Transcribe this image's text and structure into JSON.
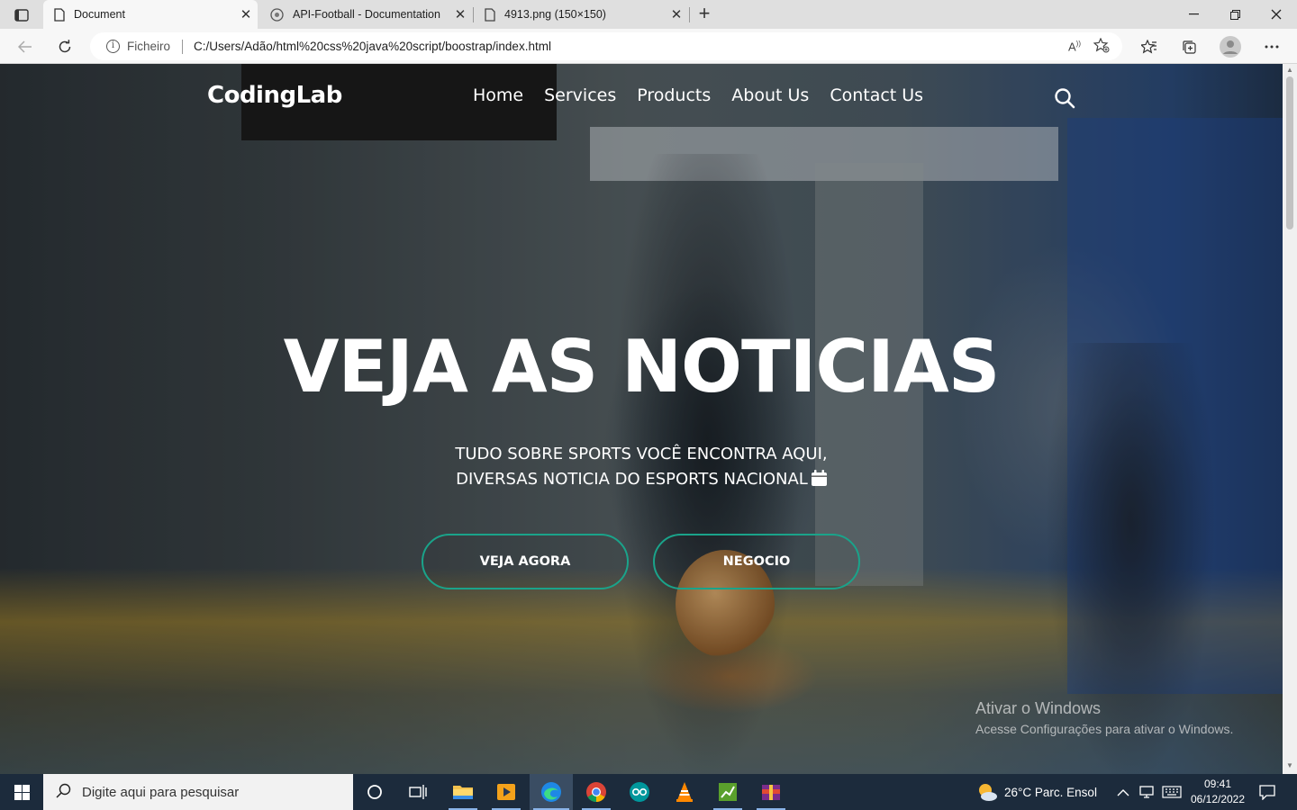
{
  "browser": {
    "tabs": [
      {
        "title": "Document",
        "active": true
      },
      {
        "title": "API-Football - Documentation",
        "active": false
      },
      {
        "title": "4913.png (150×150)",
        "active": false
      }
    ],
    "address": {
      "scheme_label": "Ficheiro",
      "url": "C:/Users/Adão/html%20css%20java%20script/boostrap/index.html"
    }
  },
  "site": {
    "brand": "CodingLab",
    "nav": [
      "Home",
      "Services",
      "Products",
      "About Us",
      "Contact Us"
    ],
    "hero": {
      "title": "VEJA AS NOTICIAS",
      "subtitle_line1": "TUDO SOBRE SPORTS VOCÊ ENCONTRA AQUI,",
      "subtitle_line2": "DIVERSAS NOTICIA DO ESPORTS NACIONAL",
      "button_primary": "VEJA AGORA",
      "button_secondary": "NEGOCIO"
    },
    "accent_color": "#1aa38a"
  },
  "windows_watermark": {
    "line1": "Ativar o Windows",
    "line2": "Acesse Configurações para ativar o Windows."
  },
  "taskbar": {
    "search_placeholder": "Digite aqui para pesquisar",
    "weather": "26°C  Parc. Ensol",
    "time": "09:41",
    "date": "06/12/2022"
  }
}
